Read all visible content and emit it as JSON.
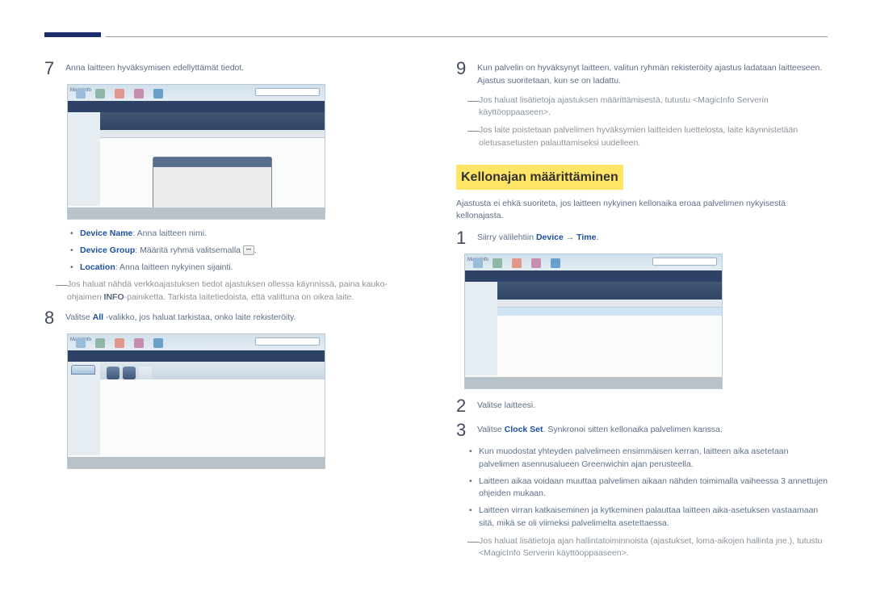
{
  "left": {
    "step7": "Anna laitteen hyväksymisen edellyttämät tiedot.",
    "b1_key": "Device Name",
    "b1_rest": ": Anna laitteen nimi.",
    "b2_key": "Device Group",
    "b2_rest_a": ": Määritä ryhmä valitsemalla ",
    "b2_rest_b": ".",
    "b3_key": "Location",
    "b3_rest": ": Anna laitteen nykyinen sijainti.",
    "note_a": "Jos haluat nähdä verkkoajastuksen tiedot ajastuksen ollessa käynnissä, paina kauko-ohjaimen ",
    "note_info": "INFO",
    "note_b": "-painiketta. Tarkista laitetiedoista, että valittuna on oikea laite.",
    "step8_a": "Valitse ",
    "step8_all": "All",
    "step8_b": " -valikko, jos haluat tarkistaa, onko laite rekisteröity."
  },
  "right": {
    "step9": "Kun palvelin on hyväksynyt laitteen, valitun ryhmän rekisteröity ajastus ladataan laitteeseen. Ajastus suoritetaan, kun se on ladattu.",
    "note1_a": "Jos haluat lisätietoja ajastuksen määrittämisestä, tutustu <",
    "note1_key": "MagicInfo Server",
    "note1_b": "in käyttöoppaaseen>.",
    "note2": "Jos laite poistetaan palvelimen hyväksymien laitteiden luettelosta, laite käynnistetään oletusasetusten palauttamiseksi uudelleen.",
    "section_title": "Kellonajan määrittäminen",
    "intro": "Ajastusta ei ehkä suoriteta, jos laitteen nykyinen kellonaika eroaa palvelimen nykyisestä kellonajasta.",
    "step1_a": "Siirry välilehtiin ",
    "step1_device": "Device",
    "step1_arrow": " → ",
    "step1_time": "Time",
    "step1_b": ".",
    "step2": "Valitse laitteesi.",
    "step3_a": "Valitse ",
    "step3_cs": "Clock Set",
    "step3_b": ". Synkronoi sitten kellonaika palvelimen kanssa.",
    "bul1": "Kun muodostat yhteyden palvelimeen ensimmäisen kerran, laitteen aika asetetaan palvelimen asennusalueen Greenwichin ajan perusteella.",
    "bul2": "Laitteen aikaa voidaan muuttaa palvelimen aikaan nähden toimimalla vaiheessa 3 annettujen ohjeiden mukaan.",
    "bul3": "Laitteen virran katkaiseminen ja kytkeminen palauttaa laitteen aika-asetuksen vastaamaan sitä, mikä se oli viimeksi palvelimelta asetettaessa.",
    "fnote_a": "Jos haluat lisätietoja ajan hallintatoiminnoista (ajastukset, loma-aikojen hallinta jne.), tutustu <",
    "fnote_key": "MagicInfo Server",
    "fnote_b": "in käyttöoppaaseen>."
  },
  "ss": {
    "logo": "MagicInfo"
  }
}
